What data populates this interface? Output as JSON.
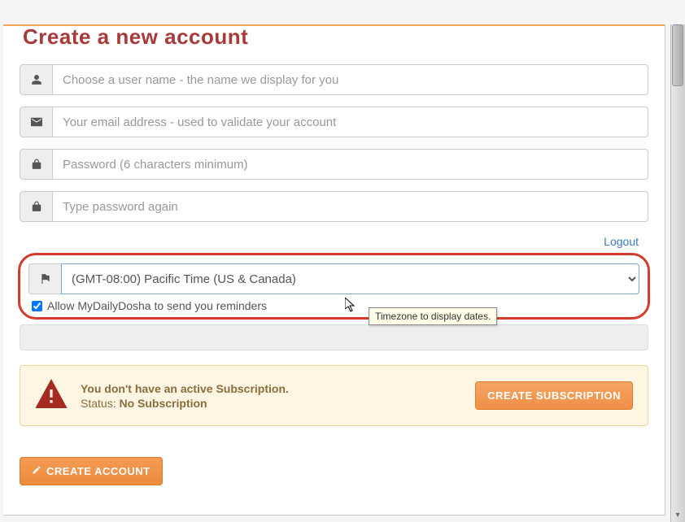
{
  "page_title": "Create a new account",
  "inputs": {
    "username_placeholder": "Choose a user name - the name we display for you",
    "email_placeholder": "Your email address - used to validate your account",
    "password_placeholder": "Password (6 characters minimum)",
    "password_confirm_placeholder": "Type password again"
  },
  "logout_label": "Logout",
  "timezone": {
    "selected": "(GMT-08:00) Pacific Time (US & Canada)",
    "tooltip": "Timezone to display dates."
  },
  "reminders_checkbox_label": "Allow MyDailyDosha to send you reminders",
  "alert": {
    "title": "You don't have an active Subscription.",
    "status_label": "Status:",
    "status_value": "No Subscription",
    "button_label": "CREATE SUBSCRIPTION"
  },
  "create_button_label": "CREATE ACCOUNT"
}
